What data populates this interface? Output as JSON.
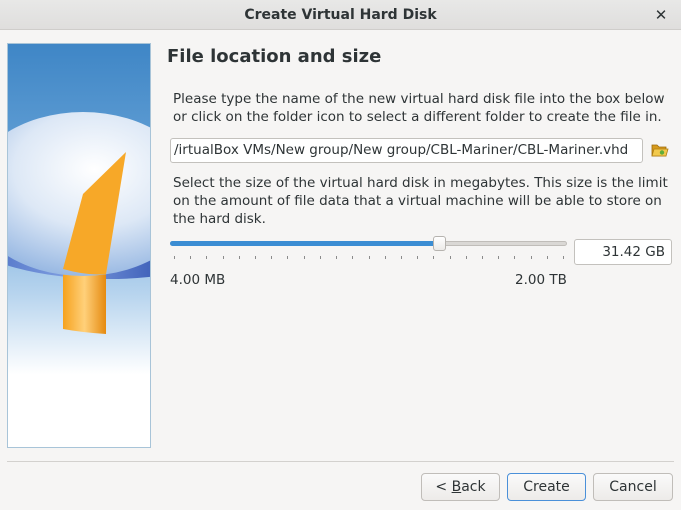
{
  "window": {
    "title": "Create Virtual Hard Disk"
  },
  "page": {
    "heading": "File location and size",
    "location_text": "Please type the name of the new virtual hard disk file into the box below or click on the folder icon to select a different folder to create the file in.",
    "file_path": "/irtualBox VMs/New group/New group/CBL-Mariner/CBL-Mariner.vhd",
    "size_text": "Select the size of the virtual hard disk in megabytes. This size is the limit on the amount of file data that a virtual machine will be able to store on the hard disk.",
    "size_value": "31.42 GB",
    "slider_fraction": 0.68,
    "min_label": "4.00 MB",
    "max_label": "2.00 TB"
  },
  "buttons": {
    "back_mnemonic": "B",
    "back_rest": "ack",
    "back_prefix": "< ",
    "create": "Create",
    "cancel": "Cancel"
  },
  "colors": {
    "accent": "#3b8dd3",
    "folder": "#e8b82f"
  },
  "icons": {
    "close": "close-icon",
    "folder": "folder-open-icon"
  }
}
